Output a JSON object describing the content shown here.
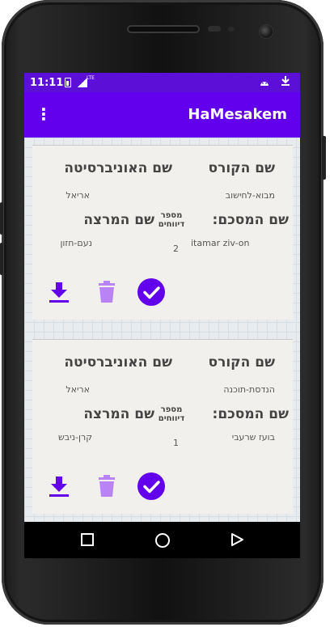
{
  "status_bar": {
    "time": "11:11",
    "lte": "LTE"
  },
  "app_bar": {
    "title": "HaMesakem",
    "menu_glyph": "⋮"
  },
  "labels": {
    "course": "שם הקורס",
    "university": "שם האוניברסיטה",
    "summarizer": "שם המסכם:",
    "lecturer": "שם המרצה",
    "reports_line1": "מספר",
    "reports_line2": "דיווחים"
  },
  "cards": [
    {
      "course": "מבוא-לחישוב",
      "university": "אריאל",
      "summarizer": "itamar ziv-on",
      "lecturer": "נעם-חזון",
      "reports": "2"
    },
    {
      "course": "הנדסת-תוכנה",
      "university": "אריאל",
      "summarizer": "בועז שרעבי",
      "lecturer": "קרן-ניבש",
      "reports": "1"
    }
  ],
  "icons": {
    "download": "download-icon",
    "delete": "trash-icon",
    "approve": "check-circle-icon",
    "back": "back-triangle-icon",
    "home": "home-circle-icon",
    "recents": "recents-square-icon"
  },
  "colors": {
    "primary": "#6200ee",
    "status_bar": "#5c0fd6",
    "accent_icon": "#8a3ffc",
    "icon_light": "#b983f5"
  }
}
